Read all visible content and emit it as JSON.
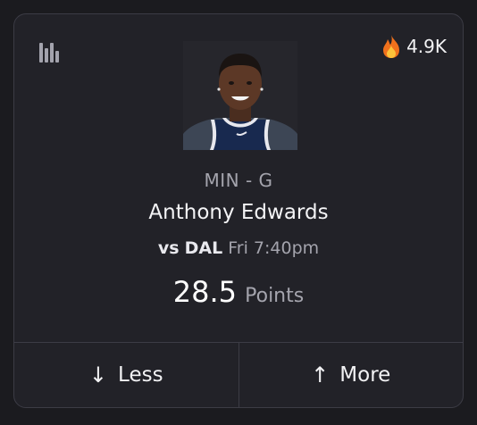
{
  "header": {
    "stats_icon": "bar-chart-icon",
    "popularity_icon": "fire-icon",
    "popularity_count": "4.9K"
  },
  "player": {
    "photo": "player-headshot",
    "team_position": "MIN - G",
    "name": "Anthony Edwards"
  },
  "matchup": {
    "vs": "vs",
    "opponent": "DAL",
    "time": "Fri 7:40pm"
  },
  "projection": {
    "line": "28.5",
    "stat": "Points"
  },
  "actions": {
    "less_icon": "arrow-down-icon",
    "less_label": "Less",
    "more_icon": "arrow-up-icon",
    "more_label": "More"
  },
  "colors": {
    "background": "#1b1b1f",
    "card": "#222228",
    "border": "#3c3c45",
    "muted_text": "#a4a4ad",
    "primary_text": "#f4f4f6"
  }
}
